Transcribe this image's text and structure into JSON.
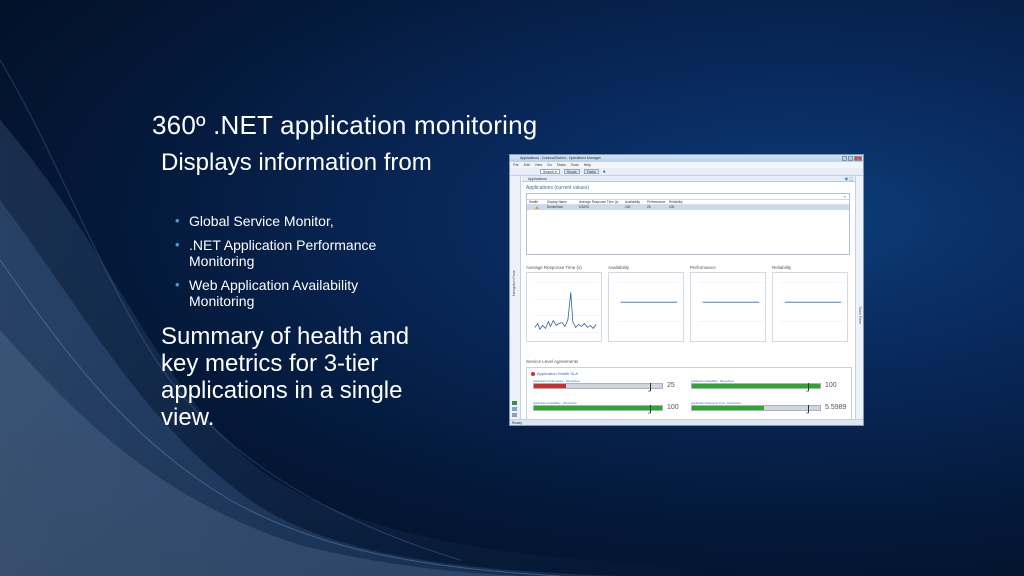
{
  "slide": {
    "title": "360º .NET application monitoring",
    "heading1": "Displays information from",
    "bullets": [
      "Global Service Monitor,",
      ".NET Application Performance Monitoring",
      "Web Application Availability Monitoring"
    ],
    "heading2": "Summary of health and key metrics for 3-tier applications in a single view.",
    "colors": {
      "background": "#041838",
      "bullet": "#3fa0e8"
    }
  },
  "app": {
    "window_title": "Applications - ContosoDistrict - Operations Manager",
    "menu": [
      "File",
      "Edit",
      "View",
      "Go",
      "Tasks",
      "Tools",
      "Help"
    ],
    "toolbar": {
      "search_label": "Search ▾",
      "scope_label": "Scope",
      "tasks_label": "Tasks"
    },
    "pane_title": "Applications",
    "grid_title": "Applications (current values)",
    "grid_columns": [
      "Health",
      "Display Name",
      "Average Response Time (s)",
      "Availability",
      "Performance",
      "Reliability"
    ],
    "grid_row": {
      "name": "DinnerNow",
      "response": "5.5293",
      "availability": "100",
      "performance": "25",
      "reliability": "100"
    },
    "nav_label": "Navigation Pane",
    "tasks_label": "Tasks Pane",
    "status": "Ready",
    "charts": [
      {
        "title": "Average Response Time (s)"
      },
      {
        "title": "Availability"
      },
      {
        "title": "Performance"
      },
      {
        "title": "Reliability"
      }
    ],
    "sla_title": "Service Level Agreements",
    "sla_header": "Application Health SLA",
    "sla_items": [
      {
        "label": "Application Performance - DinnerNow",
        "value": "25",
        "fraction": 0.25,
        "color": "#c8302a",
        "target": "90"
      },
      {
        "label": "Application Reliability - DinnerNow",
        "value": "100",
        "fraction": 1.0,
        "color": "#2ea82c",
        "target": "90"
      },
      {
        "label": "Application Availability - DinnerNow",
        "value": "100",
        "fraction": 1.0,
        "color": "#2ea82c",
        "target": "90"
      },
      {
        "label": "Application Response Time - DinnerNow",
        "value": "5.5989",
        "fraction": 0.56,
        "color": "#2ea82c",
        "target": "90"
      }
    ]
  }
}
